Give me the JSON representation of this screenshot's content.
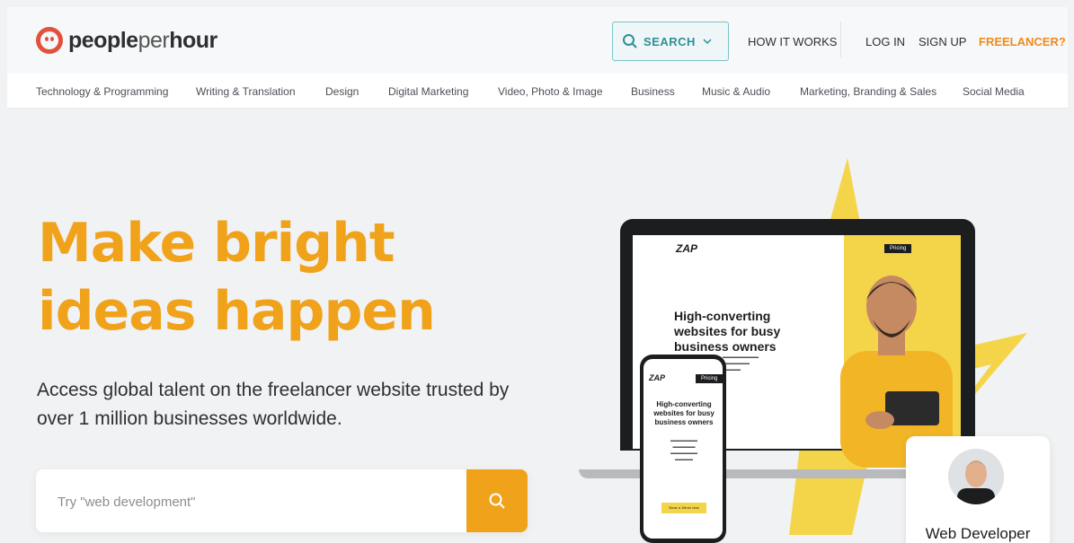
{
  "brand": {
    "logo_bold1": "people",
    "logo_light": "per",
    "logo_bold2": "hour"
  },
  "header": {
    "search_label": "SEARCH",
    "how_it_works": "HOW IT WORKS",
    "login": "LOG IN",
    "signup": "SIGN UP",
    "freelancer": "FREELANCER?"
  },
  "categories": [
    "Technology & Programming",
    "Writing & Translation",
    "Design",
    "Digital Marketing",
    "Video, Photo & Image",
    "Business",
    "Music & Audio",
    "Marketing, Branding & Sales",
    "Social Media"
  ],
  "hero": {
    "headline_line1": "Make bright",
    "headline_line2": "ideas happen",
    "subtext": "Access global talent on the freelancer website trusted by over 1 million businesses worldwide.",
    "search_placeholder": "Try \"web development\""
  },
  "mockup": {
    "brand": "ZAP",
    "nav_button": "Pricing",
    "headline": "High-converting websites for busy business owners",
    "phone_headline": "High-converting websites for busy business owners",
    "phone_cta": "Book a 15min chat"
  },
  "card": {
    "role": "Web Developer"
  },
  "colors": {
    "accent": "#f0a21b",
    "brand_red": "#e1513b",
    "teal": "#2f8f95",
    "freelancer": "#f08a1b"
  }
}
